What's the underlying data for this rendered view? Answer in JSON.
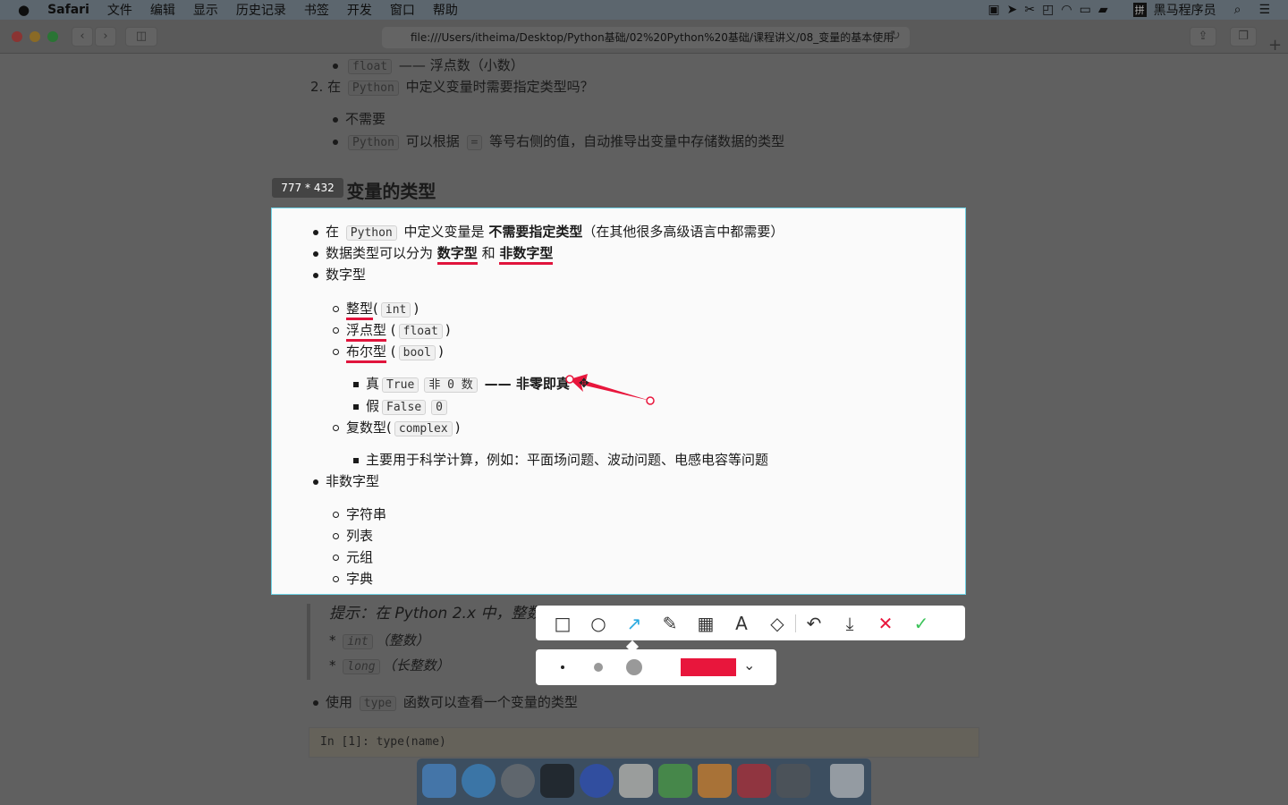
{
  "menubar": {
    "app": "Safari",
    "items": [
      "文件",
      "编辑",
      "显示",
      "历史记录",
      "书签",
      "开发",
      "窗口",
      "帮助"
    ],
    "user": "黑马程序员",
    "input_method": "拼"
  },
  "browser": {
    "url": "file:///Users/itheima/Desktop/Python基础/02%20Python%20基础/课程讲义/08_变量的基本使用"
  },
  "doc": {
    "l1": {
      "code": "float",
      "text": "—— 浮点数（小数）"
    },
    "q2": {
      "pre": "2. 在",
      "code": "Python",
      "post": "中定义变量时需要指定类型吗？"
    },
    "a1": "不需要",
    "a2": {
      "code": "Python",
      "mid": "可以根据",
      "eq": "=",
      "post": "等号右侧的值，自动推导出变量中存储数据的类型"
    },
    "heading": "2.2 变量的类型",
    "b1": {
      "pre": "在",
      "code": "Python",
      "mid": "中定义变量是",
      "bold": "不需要指定类型",
      "post": "（在其他很多高级语言中都需要）"
    },
    "b2": {
      "pre": "数据类型可以分为",
      "n1": "数字型",
      "and": "和",
      "n2": "非数字型"
    },
    "b3": "数字型",
    "int": {
      "label": "整型",
      "code": "int"
    },
    "float": {
      "label": "浮点型",
      "code": "float"
    },
    "bool": {
      "label": "布尔型",
      "code": "bool"
    },
    "true": {
      "label": "真",
      "code1": "True",
      "code2": "非 0 数",
      "post": "—— 非零即真"
    },
    "false": {
      "label": "假",
      "code1": "False",
      "code2": "0"
    },
    "complex": {
      "label": "复数型",
      "code": "complex"
    },
    "complex_note": "主要用于科学计算，例如：平面场问题、波动问题、电感电容等问题",
    "b4": "非数字型",
    "nonnum": [
      "字符串",
      "列表",
      "元组",
      "字典"
    ],
    "tip": "提示：在 Python 2.x 中，整数",
    "tip_int": {
      "code": "int",
      "text": "（整数）"
    },
    "tip_long": {
      "code": "long",
      "text": "（长整数）"
    },
    "b5": {
      "pre": "使用",
      "code": "type",
      "post": "函数可以查看一个变量的类型"
    },
    "cell": "In [1]: type(name)"
  },
  "capture": {
    "size": "777 * 432",
    "color": "#e8163c",
    "accent": "#6fd3e6"
  },
  "tools": [
    "rectangle",
    "ellipse",
    "arrow",
    "pen",
    "mosaic",
    "text",
    "tag",
    "undo",
    "download",
    "cancel",
    "confirm"
  ]
}
